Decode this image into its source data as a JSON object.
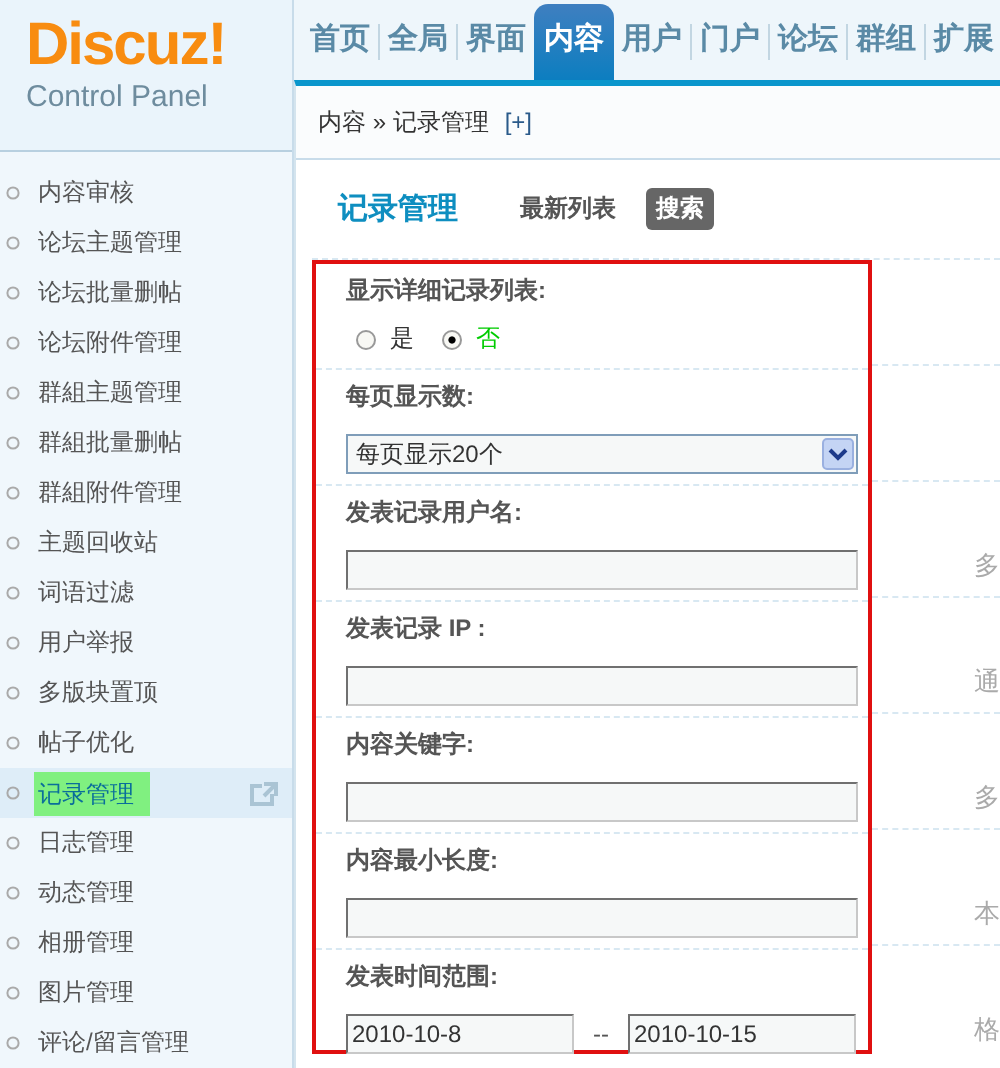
{
  "logo": {
    "title": "Discuz!",
    "subtitle": "Control Panel"
  },
  "nav": [
    {
      "label": "首页",
      "selected": false
    },
    {
      "label": "全局",
      "selected": false
    },
    {
      "label": "界面",
      "selected": false
    },
    {
      "label": "内容",
      "selected": true
    },
    {
      "label": "用户",
      "selected": false
    },
    {
      "label": "门户",
      "selected": false
    },
    {
      "label": "论坛",
      "selected": false
    },
    {
      "label": "群组",
      "selected": false
    },
    {
      "label": "扩展",
      "selected": false
    }
  ],
  "breadcrumb": {
    "path": "内容 » 记录管理",
    "action": "[+]"
  },
  "sidebar": {
    "items": [
      {
        "label": "内容审核",
        "selected": false
      },
      {
        "label": "论坛主题管理",
        "selected": false
      },
      {
        "label": "论坛批量删帖",
        "selected": false
      },
      {
        "label": "论坛附件管理",
        "selected": false
      },
      {
        "label": "群組主题管理",
        "selected": false
      },
      {
        "label": "群組批量删帖",
        "selected": false
      },
      {
        "label": "群組附件管理",
        "selected": false
      },
      {
        "label": "主题回收站",
        "selected": false
      },
      {
        "label": "词语过滤",
        "selected": false
      },
      {
        "label": "用户举报",
        "selected": false
      },
      {
        "label": "多版块置顶",
        "selected": false
      },
      {
        "label": "帖子优化",
        "selected": false
      },
      {
        "label": "记录管理",
        "selected": true
      },
      {
        "label": "日志管理",
        "selected": false
      },
      {
        "label": "动态管理",
        "selected": false
      },
      {
        "label": "相册管理",
        "selected": false
      },
      {
        "label": "图片管理",
        "selected": false
      },
      {
        "label": "评论/留言管理",
        "selected": false
      }
    ]
  },
  "page_title": "记录管理",
  "tabs": [
    {
      "label": "最新列表",
      "selected": false
    },
    {
      "label": "搜索",
      "selected": true
    }
  ],
  "form": [
    {
      "kind": "radio",
      "label": "显示详细记录列表:",
      "options": [
        {
          "label": "是",
          "selected": false
        },
        {
          "label": "否",
          "selected": true
        }
      ]
    },
    {
      "kind": "select",
      "label": "每页显示数:",
      "value": "每页显示20个"
    },
    {
      "kind": "text",
      "label": "发表记录用户名:",
      "hint": "多"
    },
    {
      "kind": "text",
      "label": "发表记录 IP :",
      "hint": "通"
    },
    {
      "kind": "text",
      "label": "内容关键字:",
      "hint": "多"
    },
    {
      "kind": "text",
      "label": "内容最小长度:",
      "hint": "本"
    },
    {
      "kind": "daterange",
      "label": "发表时间范围:",
      "from": "2010-10-8",
      "separator": "--",
      "to": "2010-10-15",
      "hint": "格"
    }
  ]
}
